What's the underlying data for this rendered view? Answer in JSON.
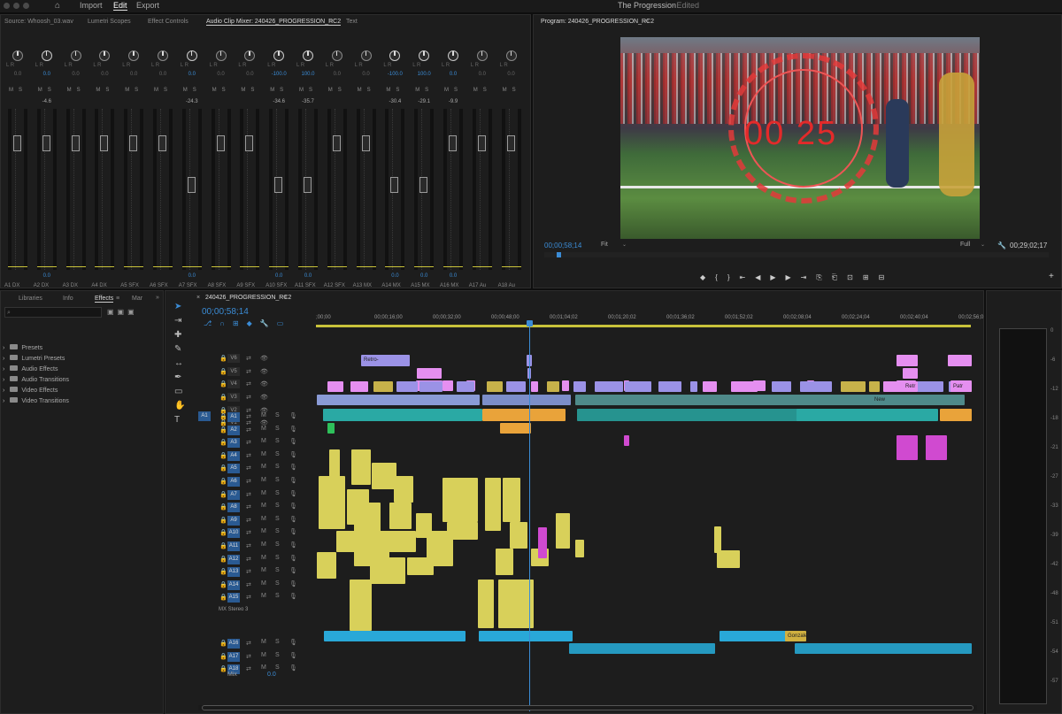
{
  "app": {
    "title": "The Progression",
    "status": "- Edited",
    "menu": [
      "Import",
      "Edit",
      "Export"
    ]
  },
  "source_tabs": [
    "Source: Whoosh_03.wav",
    "Lumetri Scopes",
    "Effect Controls",
    "Audio Clip Mixer: 240426_PROGRESSION_RC2",
    "Text"
  ],
  "program": {
    "title": "Program: 240426_PROGRESSION_RC2",
    "timecode": "00;00;58;14",
    "fit": "Fit",
    "full": "Full",
    "duration": "00;29;02;17",
    "overlay_text": "00 25"
  },
  "mixer": {
    "channels": [
      "A1",
      "A2",
      "A3",
      "A4",
      "A5",
      "A6",
      "A7",
      "A8",
      "A9",
      "A10",
      "A11",
      "A12",
      "A13",
      "A14",
      "A15",
      "A16",
      "A17",
      "A18"
    ],
    "types": [
      "DX",
      "DX",
      "DX",
      "DX",
      "SFX",
      "SFX",
      "SFX",
      "SFX",
      "SFX",
      "SFX",
      "SFX",
      "SFX",
      "MX",
      "MX",
      "MX",
      "MX",
      "Au",
      "Au"
    ],
    "pan": [
      "0.0",
      "0.0",
      "0.0",
      "0.0",
      "0.0",
      "0.0",
      "0.0",
      "0.0",
      "0.0",
      "-100.0",
      "100.0",
      "0.0",
      "0.0",
      "-100.0",
      "100.0",
      "0.0",
      "0.0",
      "0.0"
    ],
    "db": [
      "",
      "-4.6",
      "",
      "",
      "",
      "",
      "-24.3",
      "",
      "",
      "-34.6",
      "-35.7",
      "",
      "",
      "-30.4",
      "-29.1",
      "-9.9",
      "",
      ""
    ],
    "fader": [
      "",
      "0.0",
      "",
      "",
      "",
      "",
      "0.0",
      "",
      "",
      "0.0",
      "0.0",
      "",
      "",
      "0.0",
      "0.0",
      "0.0",
      "",
      ""
    ],
    "lr": "L R"
  },
  "effects_tabs": [
    "Libraries",
    "Info",
    "Effects",
    "Mar"
  ],
  "effects_folders": [
    "Presets",
    "Lumetri Presets",
    "Audio Effects",
    "Audio Transitions",
    "Video Effects",
    "Video Transitions"
  ],
  "timeline": {
    "tab": "240426_PROGRESSION_RC2",
    "timecode": "00;00;58;14",
    "ruler": [
      ";00;00",
      "00;00;16;00",
      "00;00;32;00",
      "00;00;48;00",
      "00;01;04;02",
      "00;01;20;02",
      "00;01;36;02",
      "00;01;52;02",
      "00;02;08;04",
      "00;02;24;04",
      "00;02;40;04",
      "00;02;56;0"
    ],
    "video_tracks": [
      "V6",
      "V5",
      "V4",
      "V3",
      "V2",
      "V1"
    ],
    "audio_tracks": [
      "A1",
      "A2",
      "A3",
      "A4",
      "A5",
      "A6",
      "A7",
      "A8",
      "A9",
      "A10",
      "A11",
      "A12",
      "A13",
      "A14",
      "A15",
      "A16",
      "A17",
      "A18"
    ],
    "a15_label": "MX Stereo 3",
    "mix_label": "Mix",
    "mix_value": "0.0",
    "clip_labels": {
      "retro": "Retro-",
      "new": "New",
      "retr": "Retr",
      "patr": "Patr",
      "goal": "Gonzale"
    }
  },
  "db_scale": [
    "0",
    "-6",
    "-12",
    "-18",
    "-21",
    "-27",
    "-33",
    "-39",
    "-42",
    "-48",
    "-51",
    "-54",
    "-57"
  ],
  "colors": {
    "accent": "#3b8cd6",
    "yellow": "#d8d05a",
    "pink": "#e58ff0",
    "violet": "#9b92e6",
    "teal": "#2aa9a4",
    "orange": "#e9a33a",
    "cyan": "#29a8d8"
  }
}
